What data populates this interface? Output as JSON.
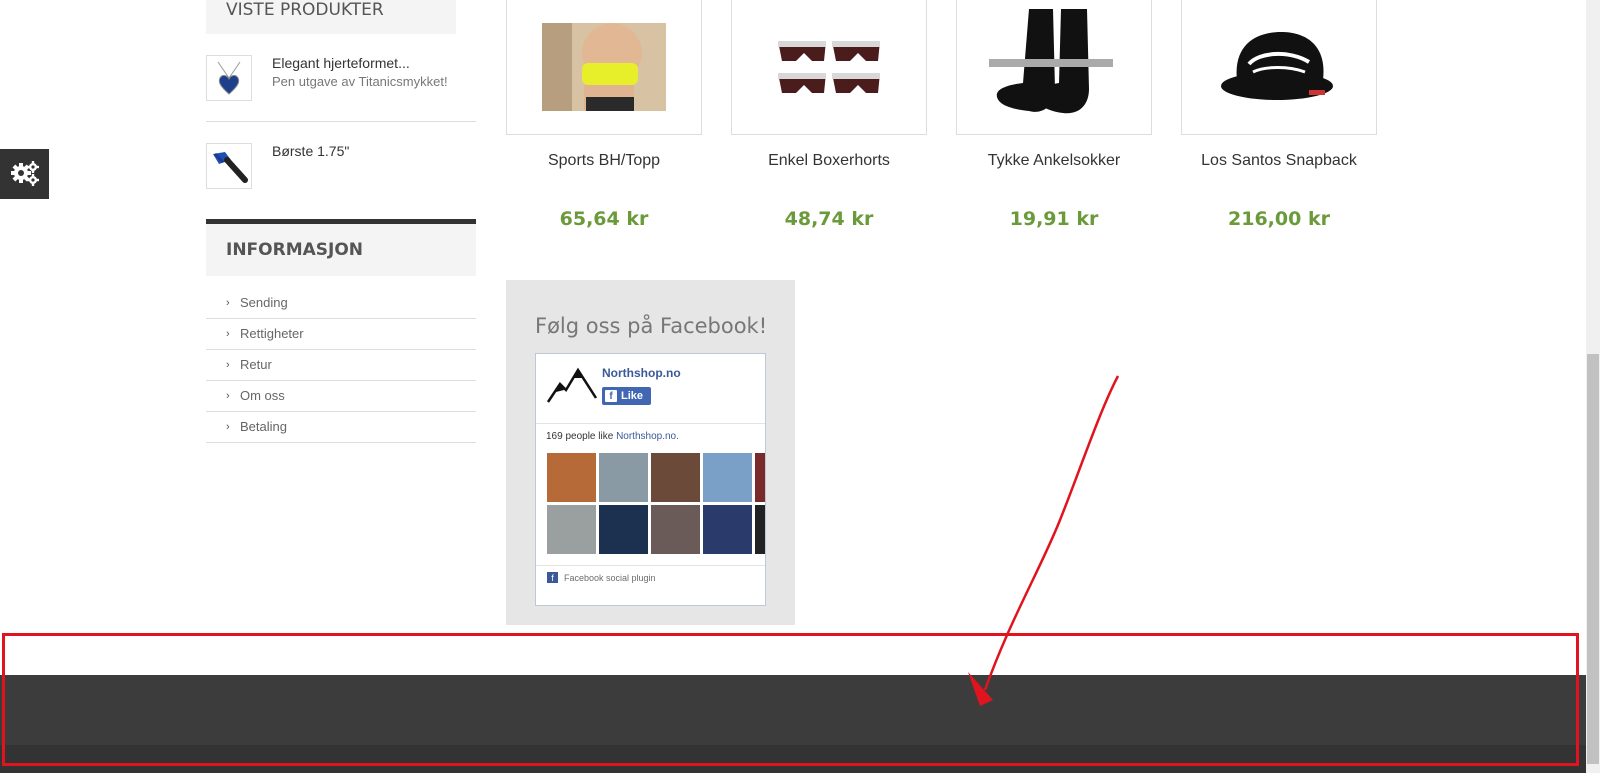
{
  "left": {
    "viewed_title": "VISTE PRODUKTER",
    "viewed": [
      {
        "name": "Elegant hjerteformet...",
        "desc": "Pen utgave av Titanicsmykket!"
      },
      {
        "name": "Børste 1.75\"",
        "desc": ""
      }
    ],
    "info_title": "INFORMASJON",
    "info_items": [
      "Sending",
      "Rettigheter",
      "Retur",
      "Om oss",
      "Betaling"
    ]
  },
  "products": [
    {
      "name": "Sports BH/Topp",
      "price": "65,64 kr"
    },
    {
      "name": "Enkel Boxerhorts",
      "price": "48,74 kr"
    },
    {
      "name": "Tykke Ankelsokker",
      "price": "19,91 kr"
    },
    {
      "name": "Los Santos Snapback",
      "price": "216,00 kr"
    }
  ],
  "facebook": {
    "title": "Følg oss på Facebook!",
    "page_name": "Northshop.no",
    "like_label": "Like",
    "count_prefix": "169 people like ",
    "count_link": "Northshop.no.",
    "plugin_label": "Facebook social plugin"
  },
  "icons": {
    "settings_toggle": "gears-icon",
    "info_bullet": "chevron-right-icon"
  },
  "colors": {
    "price": "#6a9a3a",
    "footer": "#3c3c3c",
    "annotation": "#e0141e",
    "facebook": "#3b5998"
  }
}
